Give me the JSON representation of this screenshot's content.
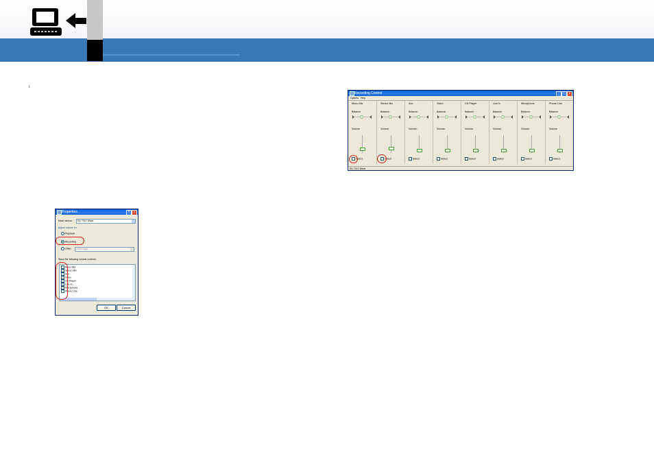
{
  "props": {
    "title": "Properties",
    "mixer_label": "Mixer device:",
    "mixer_value": "SD 7012 Wave",
    "adjust_label": "Adjust volume for",
    "radio_playback": "Playback",
    "radio_recording": "Recording",
    "radio_other": "Other",
    "other_value": "Voice Input",
    "show_label": "Show the following volume controls:",
    "controls": [
      "Mono Mix",
      "Stereo Mix",
      "Aux",
      "Video",
      "CD Player",
      "Line In",
      "Microphone",
      "Phone Line"
    ],
    "ok_label": "OK",
    "cancel_label": "Cancel"
  },
  "rec": {
    "title": "Recording Control",
    "menu_options": "Options",
    "menu_help": "Help",
    "balance_label": "Balance:",
    "volume_label": "Volume:",
    "select_label": "Select",
    "status": "SD 7012 Wave",
    "columns": [
      {
        "name": "Mono Mix",
        "selected": false,
        "volume": 0.2
      },
      {
        "name": "Stereo Mix",
        "selected": true,
        "volume": 0.25
      },
      {
        "name": "Aux",
        "selected": false,
        "volume": 0.1
      },
      {
        "name": "Video",
        "selected": false,
        "volume": 0.1
      },
      {
        "name": "CD Player",
        "selected": false,
        "volume": 0.1
      },
      {
        "name": "Line In",
        "selected": false,
        "volume": 0.1
      },
      {
        "name": "Microphone",
        "selected": false,
        "volume": 0.1
      },
      {
        "name": "Phone Line",
        "selected": false,
        "volume": 0.1
      }
    ]
  },
  "colors": {
    "band": "#3a78b5",
    "accent_red": "#e0201a",
    "xp_title": "#0a5fd8"
  }
}
